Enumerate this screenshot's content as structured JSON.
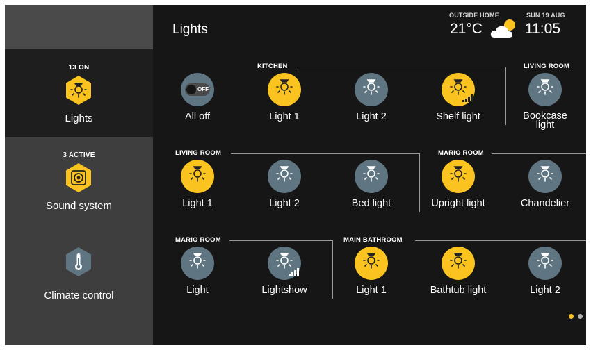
{
  "app": {
    "title": "Lights"
  },
  "header": {
    "weather_label": "OUTSIDE HOME",
    "temperature": "21°C",
    "weather_icon": "partly-cloudy-icon",
    "date": "SUN 19 AUG",
    "time": "11:05"
  },
  "sidebar": {
    "items": [
      {
        "count": "13 ON",
        "label": "Lights",
        "icon": "lightbulb-icon",
        "active": true
      },
      {
        "count": "3 ACTIVE",
        "label": "Sound system",
        "icon": "speaker-icon",
        "active": false
      },
      {
        "count": "",
        "label": "Climate control",
        "icon": "thermometer-icon",
        "active": false
      }
    ]
  },
  "groups": {
    "kitchen": "KITCHEN",
    "living_room_top": "LIVING ROOM",
    "living_room": "LIVING ROOM",
    "mario_room_mid": "MARIO ROOM",
    "mario_room_bottom": "MARIO ROOM",
    "main_bathroom": "MAIN BATHROOM"
  },
  "tiles": [
    {
      "label": "All off",
      "state": "off-toggle",
      "toggle_text": "OFF"
    },
    {
      "label": "Light 1",
      "state": "on"
    },
    {
      "label": "Light 2",
      "state": "off"
    },
    {
      "label": "Shelf light",
      "state": "on",
      "dimmer": true
    },
    {
      "label": "Bookcase light",
      "state": "off"
    },
    {
      "label": "Light 1",
      "state": "on"
    },
    {
      "label": "Light 2",
      "state": "off"
    },
    {
      "label": "Bed light",
      "state": "off"
    },
    {
      "label": "Upright light",
      "state": "on"
    },
    {
      "label": "Chandelier",
      "state": "off"
    },
    {
      "label": "Light",
      "state": "off"
    },
    {
      "label": "Lightshow",
      "state": "off",
      "dimmer": true
    },
    {
      "label": "Light 1",
      "state": "on"
    },
    {
      "label": "Bathtub light",
      "state": "on"
    },
    {
      "label": "Light 2",
      "state": "off"
    }
  ],
  "pagination": {
    "pages": 2,
    "current": 1
  },
  "colors": {
    "on": "#fbc31f",
    "off": "#5f7582",
    "accent": "#fbc31f",
    "background": "#161616"
  }
}
